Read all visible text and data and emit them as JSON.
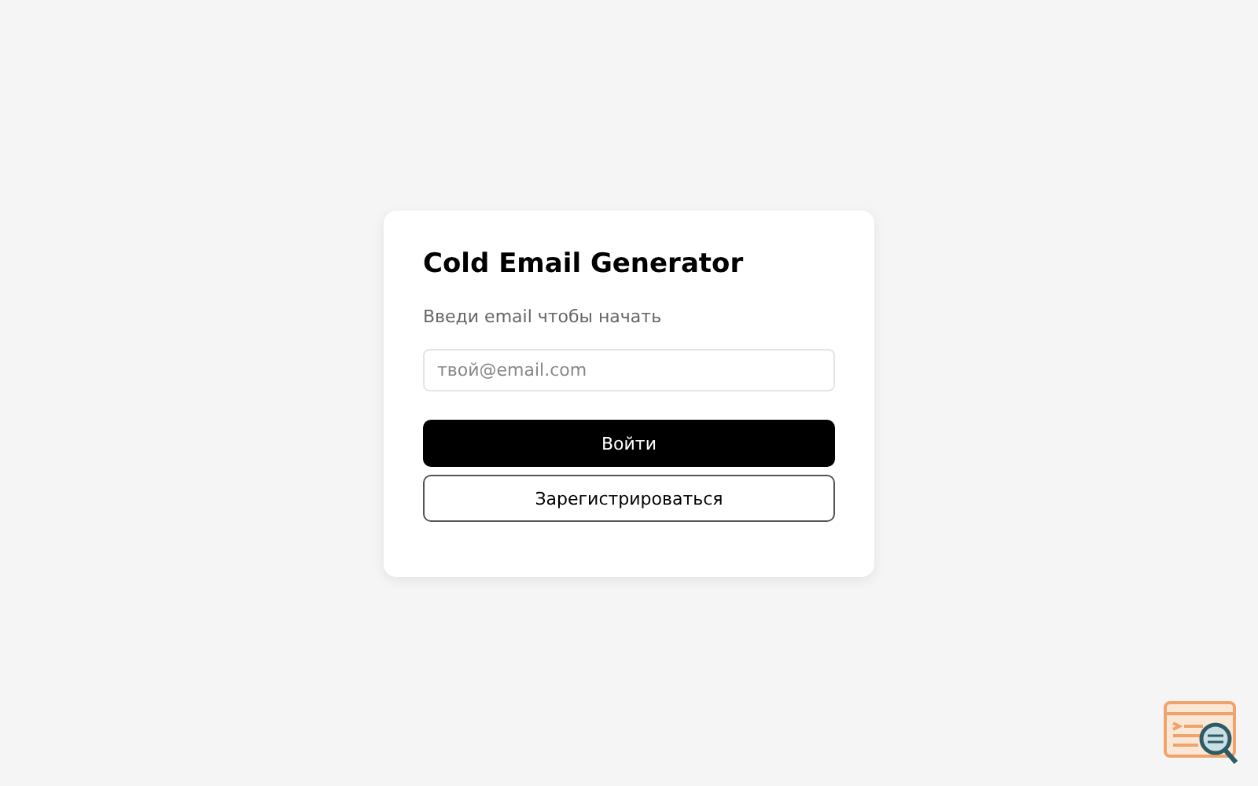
{
  "card": {
    "title": "Cold Email Generator",
    "subtitle": "Введи email чтобы начать"
  },
  "email_field": {
    "placeholder": "твой@email.com"
  },
  "buttons": [
    {
      "label": "Войти",
      "kind": "primary"
    },
    {
      "label": "Зарегистрироваться",
      "kind": "secondary"
    }
  ]
}
